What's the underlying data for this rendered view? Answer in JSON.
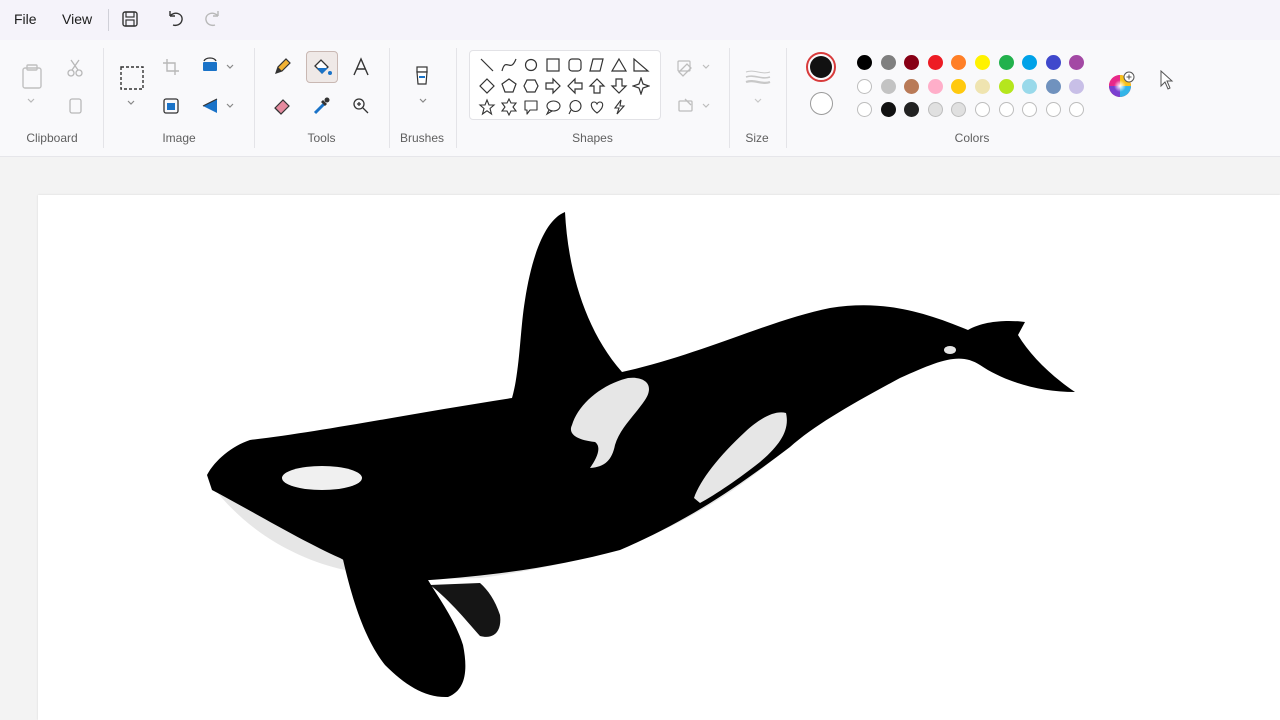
{
  "menu": {
    "file": "File",
    "view": "View"
  },
  "quick_access": [
    "save-icon",
    "undo-icon",
    "redo-icon"
  ],
  "groups": {
    "clipboard": "Clipboard",
    "image": "Image",
    "tools": "Tools",
    "brushes": "Brushes",
    "shapes": "Shapes",
    "size": "Size",
    "colors": "Colors"
  },
  "active_tool": "fill-bucket",
  "colors": {
    "primary": "#111111",
    "secondary": "#ffffff",
    "palette_row1": [
      "#000000",
      "#7f7f7f",
      "#880015",
      "#ed1c24",
      "#ff7f27",
      "#fff200",
      "#22b14c",
      "#00a2e8",
      "#3f48cc",
      "#a349a4"
    ],
    "palette_row2": [
      "#ffffff",
      "#c3c3c3",
      "#b97a57",
      "#ffaec9",
      "#ffc90e",
      "#efe4b0",
      "#b5e61d",
      "#99d9ea",
      "#7092be",
      "#c8bfe7"
    ],
    "palette_row3": [
      "#ffffff",
      "#111111",
      "#222222",
      "#e0e0e0",
      "#e0e0e0",
      "#ffffff",
      "#ffffff",
      "#ffffff",
      "#ffffff",
      "#ffffff"
    ]
  },
  "canvas": {
    "subject": "orca-drawing"
  }
}
